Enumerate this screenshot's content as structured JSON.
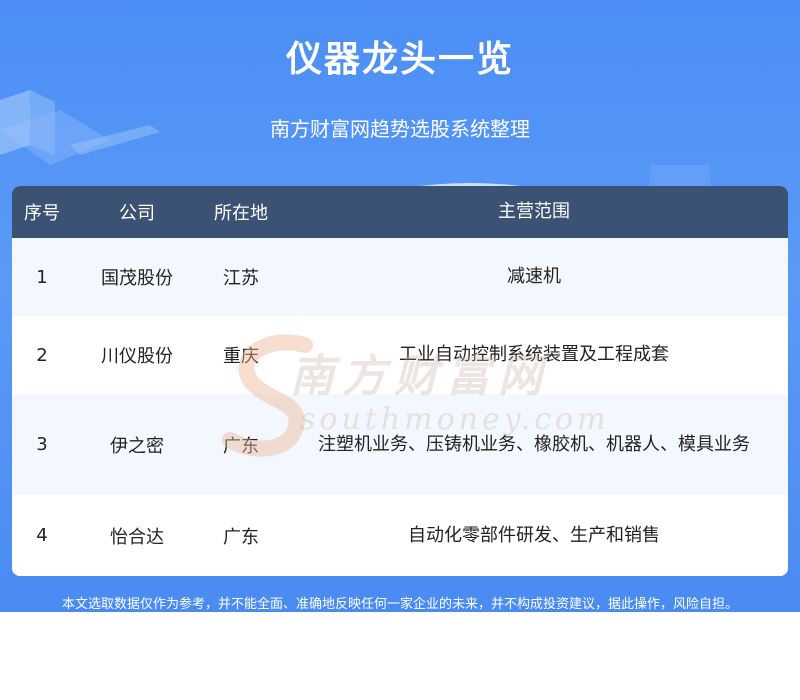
{
  "header": {
    "title": "仪器龙头一览",
    "subtitle": "南方财富网趋势选股系统整理"
  },
  "table": {
    "columns": [
      "序号",
      "公司",
      "所在地",
      "主营范围"
    ],
    "rows": [
      {
        "no": "1",
        "company": "国茂股份",
        "location": "江苏",
        "business": "减速机"
      },
      {
        "no": "2",
        "company": "川仪股份",
        "location": "重庆",
        "business": "工业自动控制系统装置及工程成套"
      },
      {
        "no": "3",
        "company": "伊之密",
        "location": "广东",
        "business": "注塑机业务、压铸机业务、橡胶机、机器人、模具业务"
      },
      {
        "no": "4",
        "company": "怡合达",
        "location": "广东",
        "business": "自动化零部件研发、生产和销售"
      }
    ]
  },
  "watermark": {
    "cn": "南方财富网",
    "en": "southmoney.com"
  },
  "footer": {
    "disclaimer": "本文选取数据仅作为参考，并不能全面、准确地反映任何一家企业的未来，并不构成投资建议，据此操作，风险自担。"
  },
  "colors": {
    "banner": "#4b8ef5",
    "table_header": "#3b5275",
    "row_alt": "#f3f7fe"
  }
}
